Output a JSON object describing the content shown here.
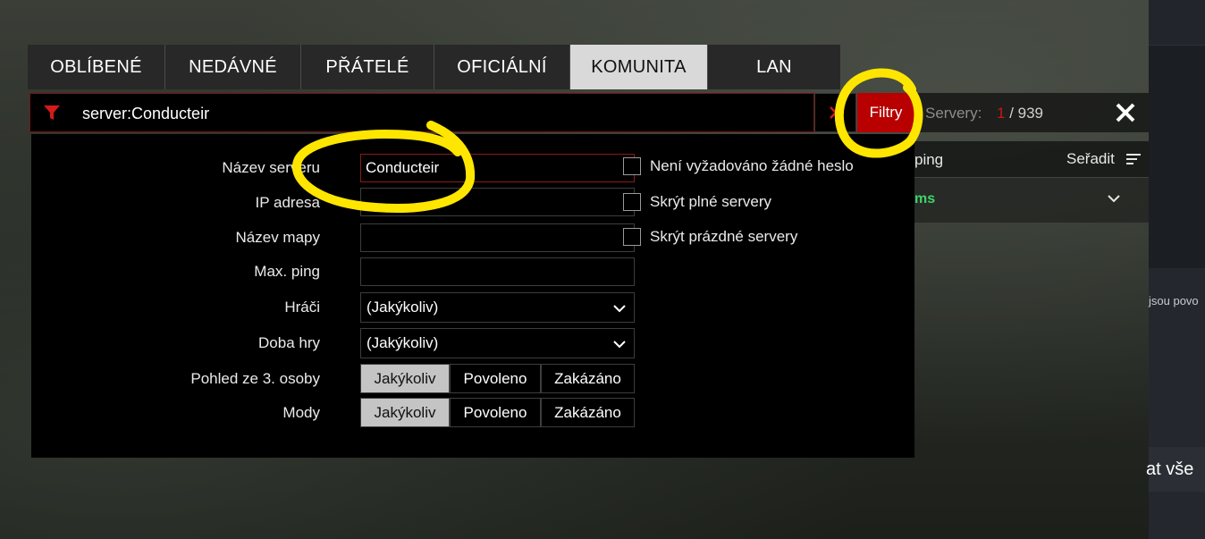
{
  "tabs": [
    {
      "label": "OBLÍBENÉ",
      "active": false
    },
    {
      "label": "NEDÁVNÉ",
      "active": false
    },
    {
      "label": "PŘÁTELÉ",
      "active": false
    },
    {
      "label": "OFICIÁLNÍ",
      "active": false
    },
    {
      "label": "KOMUNITA",
      "active": true
    },
    {
      "label": "LAN",
      "active": false
    }
  ],
  "search": {
    "value": "server:Conducteir",
    "clear_icon": "close-icon",
    "filter_icon": "funnel-icon"
  },
  "filters_button": {
    "label": "Filtry"
  },
  "servers": {
    "label": "Servery:",
    "selected": "1",
    "separator": " / ",
    "total": "939"
  },
  "list": {
    "ping_label": "ping",
    "sort_label": "Seřadit",
    "row_ping": "ms"
  },
  "filter_form": {
    "server_name": {
      "label": "Název serveru",
      "value": "Conducteir"
    },
    "ip_address": {
      "label": "IP adresa",
      "value": ""
    },
    "map_name": {
      "label": "Název mapy",
      "value": ""
    },
    "max_ping": {
      "label": "Max. ping",
      "value": ""
    },
    "players": {
      "label": "Hráči",
      "value": "(Jakýkoliv)"
    },
    "game_time": {
      "label": "Doba hry",
      "value": "(Jakýkoliv)"
    },
    "third_person": {
      "label": "Pohled ze 3. osoby",
      "options": [
        "Jakýkoliv",
        "Povoleno",
        "Zakázáno"
      ],
      "selected": "Jakýkoliv"
    },
    "mods": {
      "label": "Mody",
      "options": [
        "Jakýkoliv",
        "Povoleno",
        "Zakázáno"
      ],
      "selected": "Jakýkoliv"
    },
    "checkboxes": [
      {
        "label": "Není vyžadováno žádné heslo",
        "checked": false
      },
      {
        "label": "Skrýt plné servery",
        "checked": false
      },
      {
        "label": "Skrýt prázdné servery",
        "checked": false
      }
    ]
  },
  "side_panel": {
    "partial_text": "jsou povo",
    "partial_button": "at vše"
  },
  "colors": {
    "accent_red": "#b80000",
    "annotation_yellow": "#ffe600",
    "ping_green": "#3fd46a"
  }
}
